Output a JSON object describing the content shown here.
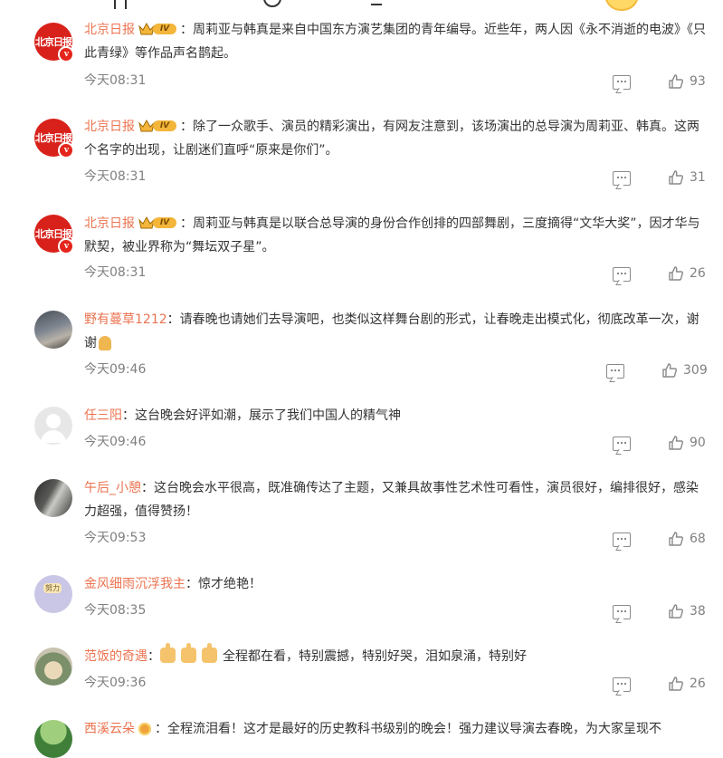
{
  "colors": {
    "name": "#eb7350",
    "text": "#333333",
    "meta": "#808080",
    "badge": "#e5251b"
  },
  "comments": [
    {
      "user": "北京日报",
      "text": "：周莉亚与韩真是来自中国东方演艺集团的青年编导。近些年，两人因《永不消逝的电波》《只此青绿》等作品声名鹊起。",
      "time": "今天08:31",
      "likes": "93",
      "badge": "IV",
      "avatar": "北京日报"
    },
    {
      "user": "北京日报",
      "text": "：除了一众歌手、演员的精彩演出，有网友注意到，该场演出的总导演为周莉亚、韩真。这两个名字的出现，让剧迷们直呼“原来是你们”。",
      "time": "今天08:31",
      "likes": "31",
      "badge": "IV",
      "avatar": "北京日报"
    },
    {
      "user": "北京日报",
      "text": "：周莉亚与韩真是以联合总导演的身份合作创排的四部舞剧，三度摘得“文华大奖”，因才华与默契，被业界称为“舞坛双子星”。",
      "time": "今天08:31",
      "likes": "26",
      "badge": "IV",
      "avatar": "北京日报"
    },
    {
      "user": "野有蔓草1212",
      "text": "：请春晚也请她们去导演吧，也类似这样舞台剧的形式，让春晚走出模式化，彻底改革一次，谢谢",
      "time": "今天09:46",
      "likes": "309"
    },
    {
      "user": "任三阳",
      "text": "：这台晚会好评如潮，展示了我们中国人的精气神",
      "time": "今天09:46",
      "likes": "90"
    },
    {
      "user": "午后_小憩",
      "text": "：这台晚会水平很高，既准确传达了主题，又兼具故事性艺术性可看性，演员很好，编排很好，感染力超强，值得赞扬！",
      "time": "今天09:53",
      "likes": "68"
    },
    {
      "user": "金风细雨沉浮我主",
      "text": "：惊才绝艳！",
      "time": "今天08:35",
      "likes": "38",
      "avatar_text": "努力"
    },
    {
      "user": "范饭的奇遇",
      "text": "全程都在看，特别震撼，特别好哭，泪如泉涌，特别好",
      "time": "今天09:36",
      "likes": "26"
    },
    {
      "user": "西溪云朵",
      "text": "：全程流泪看！这才是最好的历史教科书级别的晚会！强力建议导演去春晚，为大家呈现不",
      "time": "",
      "likes": ""
    }
  ]
}
